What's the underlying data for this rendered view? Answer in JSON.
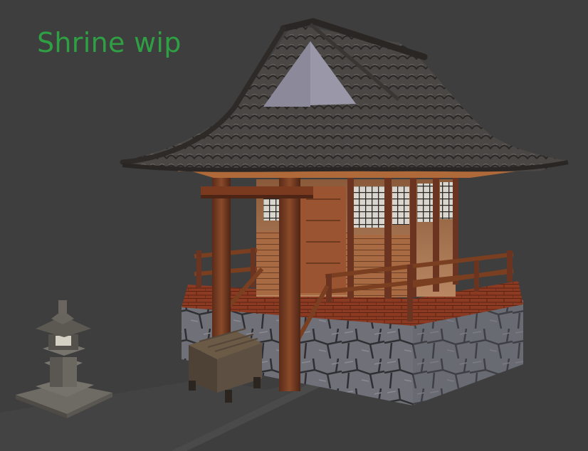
{
  "viewport": {
    "title": "Shrine wip",
    "title_color": "#2ea043",
    "background_color": "#3e3e3e"
  },
  "scene": {
    "objects": [
      "shrine-model",
      "stone-lantern-model",
      "wooden-offering-box-model",
      "ground-path"
    ]
  }
}
